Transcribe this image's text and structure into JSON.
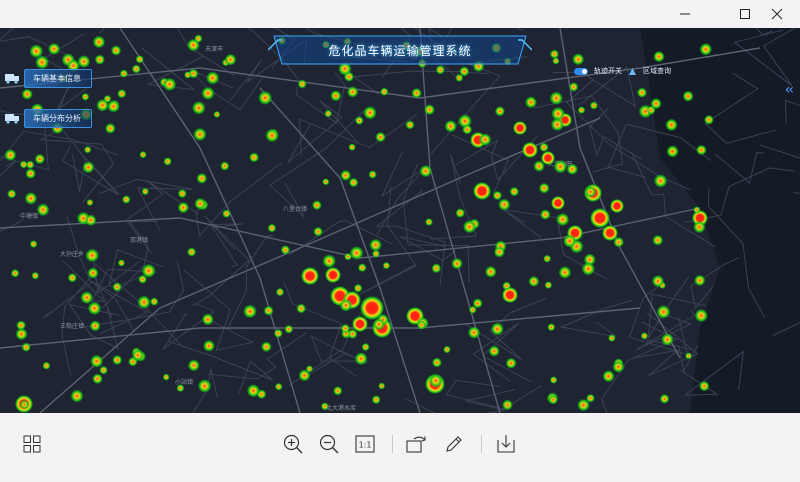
{
  "window": {
    "controls": [
      {
        "name": "minimize-button",
        "glyph": "—"
      },
      {
        "name": "maximize-button",
        "glyph": "☐"
      },
      {
        "name": "close-button",
        "glyph": "✕"
      }
    ]
  },
  "app": {
    "title": "危化品车辆运输管理系统",
    "side_buttons": [
      {
        "label": "车辆基本信息",
        "icon": "truck-icon"
      },
      {
        "label": "车辆分布分析",
        "icon": "truck-icon"
      }
    ],
    "toggles": {
      "track_switch_label": "轨迹开关",
      "area_query_label": "区域查询"
    }
  },
  "map": {
    "place_labels": [
      "天津市",
      "八里台镇",
      "双港镇",
      "大孙庄乡",
      "王稳庄镇",
      "小站镇",
      "北大港水库",
      "大港油田",
      "中塘镇"
    ],
    "heat_colors": {
      "low": "#16c216",
      "mid": "#f2e01a",
      "high": "#ff1a1a"
    },
    "background": "#1d2330"
  },
  "toolbar": {
    "buttons": [
      {
        "name": "gallery-view-button",
        "icon": "grid-icon"
      },
      {
        "name": "zoom-in-button",
        "icon": "zoom-in-icon"
      },
      {
        "name": "zoom-out-button",
        "icon": "zoom-out-icon"
      },
      {
        "name": "actual-size-button",
        "icon": "one-to-one-icon",
        "text": "1:1"
      },
      {
        "name": "rotate-button",
        "icon": "rotate-icon"
      },
      {
        "name": "edit-button",
        "icon": "pencil-icon"
      },
      {
        "name": "save-button",
        "icon": "download-icon"
      }
    ]
  }
}
